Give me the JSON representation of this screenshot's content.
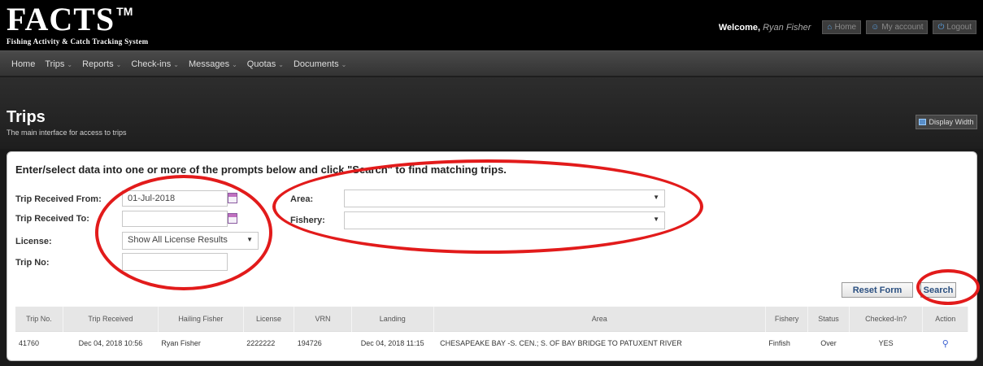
{
  "header": {
    "logo_main": "FACTS",
    "logo_tm": "TM",
    "logo_sub": "Fishing Activity & Catch Tracking System",
    "welcome_label": "Welcome,",
    "user_name": "Ryan Fisher",
    "buttons": [
      {
        "label": "Home",
        "icon": "home-icon"
      },
      {
        "label": "My account",
        "icon": "user-icon"
      },
      {
        "label": "Logout",
        "icon": "power-icon"
      }
    ]
  },
  "nav": {
    "items": [
      {
        "label": "Home",
        "dropdown": false
      },
      {
        "label": "Trips",
        "dropdown": true
      },
      {
        "label": "Reports",
        "dropdown": true
      },
      {
        "label": "Check-ins",
        "dropdown": true
      },
      {
        "label": "Messages",
        "dropdown": true
      },
      {
        "label": "Quotas",
        "dropdown": true
      },
      {
        "label": "Documents",
        "dropdown": true
      }
    ]
  },
  "page": {
    "title": "Trips",
    "subtitle": "The main interface for access to trips",
    "display_width_label": "Display Width"
  },
  "form": {
    "instructions": "Enter/select data into one or more of the prompts below and click \"Search\" to find matching trips.",
    "received_from_label": "Trip Received From:",
    "received_from_value": "01-Jul-2018",
    "received_to_label": "Trip Received To:",
    "received_to_value": "",
    "license_label": "License:",
    "license_value": "Show All License Results",
    "trip_no_label": "Trip No:",
    "trip_no_value": "",
    "area_label": "Area:",
    "area_value": "",
    "fishery_label": "Fishery:",
    "fishery_value": "",
    "reset_label": "Reset Form",
    "search_label": "Search"
  },
  "table": {
    "columns": [
      "Trip No.",
      "Trip Received",
      "Hailing Fisher",
      "License",
      "VRN",
      "Landing",
      "Area",
      "Fishery",
      "Status",
      "Checked-In?",
      "Action"
    ],
    "rows": [
      {
        "trip_no": "41760",
        "trip_received": "Dec 04, 2018 10:56",
        "hailing_fisher": "Ryan Fisher",
        "license": "2222222",
        "vrn": "194726",
        "landing": "Dec 04, 2018 11:15",
        "area": "CHESAPEAKE BAY -S. CEN.; S. OF BAY BRIDGE TO PATUXENT RIVER",
        "fishery": "Finfish",
        "status": "Over",
        "checked_in": "YES",
        "action_icon": "magnifier-icon"
      }
    ]
  },
  "colors": {
    "annotation": "#e21b1b",
    "header_bg": "#000000",
    "button_text": "#2a4f80"
  }
}
